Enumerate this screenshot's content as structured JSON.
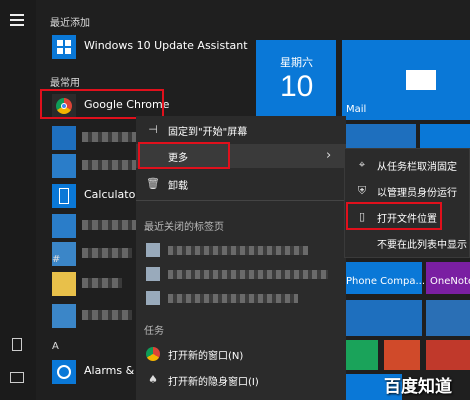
{
  "sidebar": {
    "menu_icon": "hamburger-icon",
    "bottom_icons": [
      "document-icon",
      "pictures-icon"
    ]
  },
  "app_list": {
    "section_recent": "最近添加",
    "recent_item": "Windows 10 Update Assistant",
    "section_frequent": "最常用",
    "frequent_item": "Google Chrome",
    "calculator": "Calculator",
    "letter_hash": "#",
    "letter_a": "A",
    "alarms": "Alarms & C"
  },
  "tiles": {
    "calendar_day": "星期六",
    "calendar_date": "10",
    "mail": "Mail",
    "phone": "Phone Compa...",
    "onenote": "OneNote",
    "watermark": "百度知道"
  },
  "context_menu": {
    "pin_to_start": "固定到\"开始\"屏幕",
    "more": "更多",
    "uninstall": "卸载",
    "recent_tabs_header": "最近关闭的标签页",
    "tasks_header": "任务",
    "new_window": "打开新的窗口(N)",
    "new_incognito": "打开新的隐身窗口(I)"
  },
  "submenu": {
    "unpin_taskbar": "从任务栏取消固定",
    "run_as_admin": "以管理员身份运行",
    "open_file_location": "打开文件位置",
    "hide_in_list": "不要在此列表中显示"
  },
  "colors": {
    "tile_blue": "#0a78d7",
    "tile_purple": "#7a1fa2",
    "highlight_red": "#e0101c"
  }
}
